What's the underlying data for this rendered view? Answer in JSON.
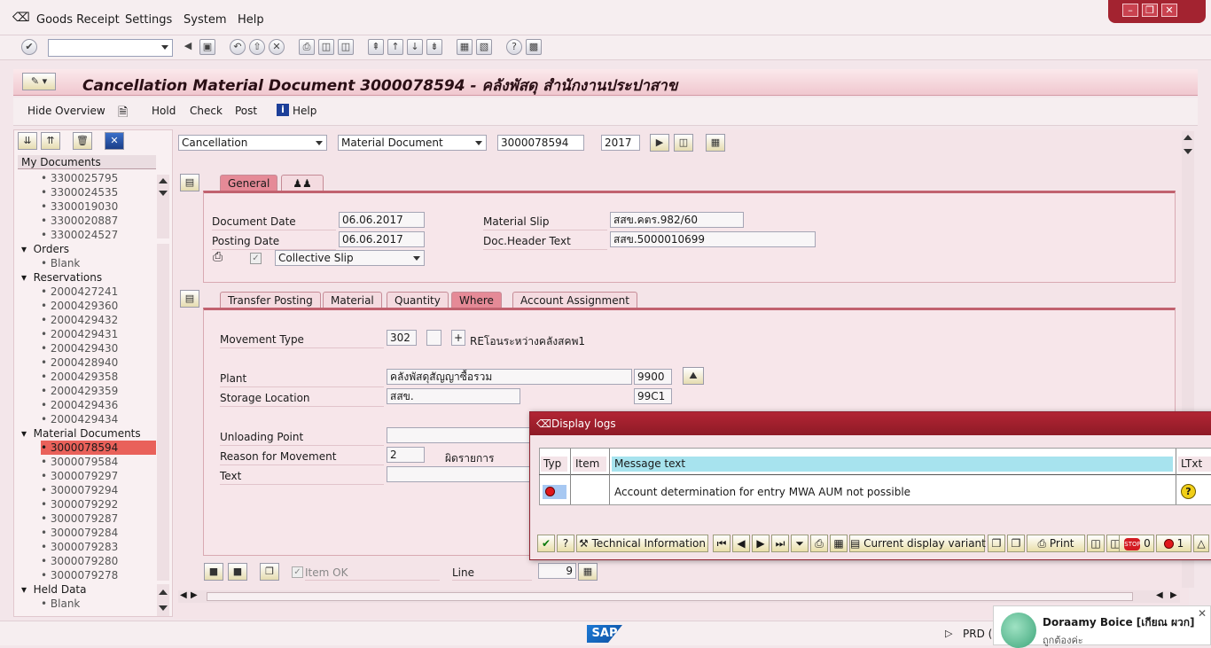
{
  "menu": {
    "goods_receipt": "Goods Receipt",
    "settings": "Settings",
    "system": "System",
    "help": "Help"
  },
  "title": "Cancellation Material Document 3000078594 - คลังพัสดุ สำนักงานประปาสาข",
  "app_toolbar": {
    "hide_overview": "Hide Overview",
    "hold": "Hold",
    "check": "Check",
    "post": "Post",
    "help": "Help"
  },
  "tree": {
    "my_documents": "My Documents",
    "my_documents_items": [
      "3300025795",
      "3300024535",
      "3300019030",
      "3300020887",
      "3300024527"
    ],
    "orders": "Orders",
    "orders_items": [
      "Blank"
    ],
    "reservations": "Reservations",
    "reservations_items": [
      "2000427241",
      "2000429360",
      "2000429432",
      "2000429431",
      "2000429430",
      "2000428940",
      "2000429358",
      "2000429359",
      "2000429436",
      "2000429434"
    ],
    "material_documents": "Material Documents",
    "material_documents_items": [
      "3000078594",
      "3000079584",
      "3000079297",
      "3000079294",
      "3000079292",
      "3000079287",
      "3000079284",
      "3000079283",
      "3000079280",
      "3000079278"
    ],
    "held_data": "Held Data",
    "held_data_items": [
      "Blank"
    ]
  },
  "header_row": {
    "action": "Cancellation",
    "reference": "Material Document",
    "doc_number": "3000078594",
    "year": "2017"
  },
  "general_tab": {
    "tab_label": "General",
    "document_date_label": "Document Date",
    "document_date": "06.06.2017",
    "posting_date_label": "Posting Date",
    "posting_date": "06.06.2017",
    "material_slip_label": "Material Slip",
    "material_slip": "สสข.คตร.982/60",
    "doc_header_text_label": "Doc.Header Text",
    "doc_header_text": "สสข.5000010699",
    "slip_type": "Collective Slip"
  },
  "item_tabs": [
    "Transfer Posting",
    "Material",
    "Quantity",
    "Where",
    "Account Assignment"
  ],
  "where_tab": {
    "movement_type_label": "Movement Type",
    "movement_type": "302",
    "movement_plus": "+",
    "movement_text": "REโอนระหว่างคลังสคพ1",
    "plant_label": "Plant",
    "plant_name": "คลังพัสดุสัญญาซื้อรวม",
    "plant_code": "9900",
    "storage_location_label": "Storage Location",
    "storage_location_name": "สสข.",
    "storage_location_code": "99C1",
    "unloading_point_label": "Unloading Point",
    "reason_label": "Reason for Movement",
    "reason_code": "2",
    "reason_text": "ผิดรายการ",
    "text_label": "Text"
  },
  "bottom_bar": {
    "item_ok": "Item OK",
    "line_label": "Line",
    "line_value": "9"
  },
  "dialog": {
    "title": "Display logs",
    "columns": [
      "Typ",
      "Item",
      "Message text",
      "LTxt"
    ],
    "row_message": "Account determination for entry MWA AUM not possible",
    "technical_information": "Technical Information",
    "current_display_variant": "Current display variant",
    "print": "Print",
    "stop_count": "0",
    "error_count": "1"
  },
  "status": {
    "system": "PRD (",
    "sap_logo": "SAP"
  },
  "notification": {
    "name": "Doraamy Boice [เกียณ ผวก]",
    "message": "ถูกต้องค่ะ"
  },
  "colors": {
    "title_bar": "#f0c7cf",
    "dialog_title": "#a32330",
    "selected_row": "#e9615a",
    "log_header": "#a7e3ee"
  }
}
